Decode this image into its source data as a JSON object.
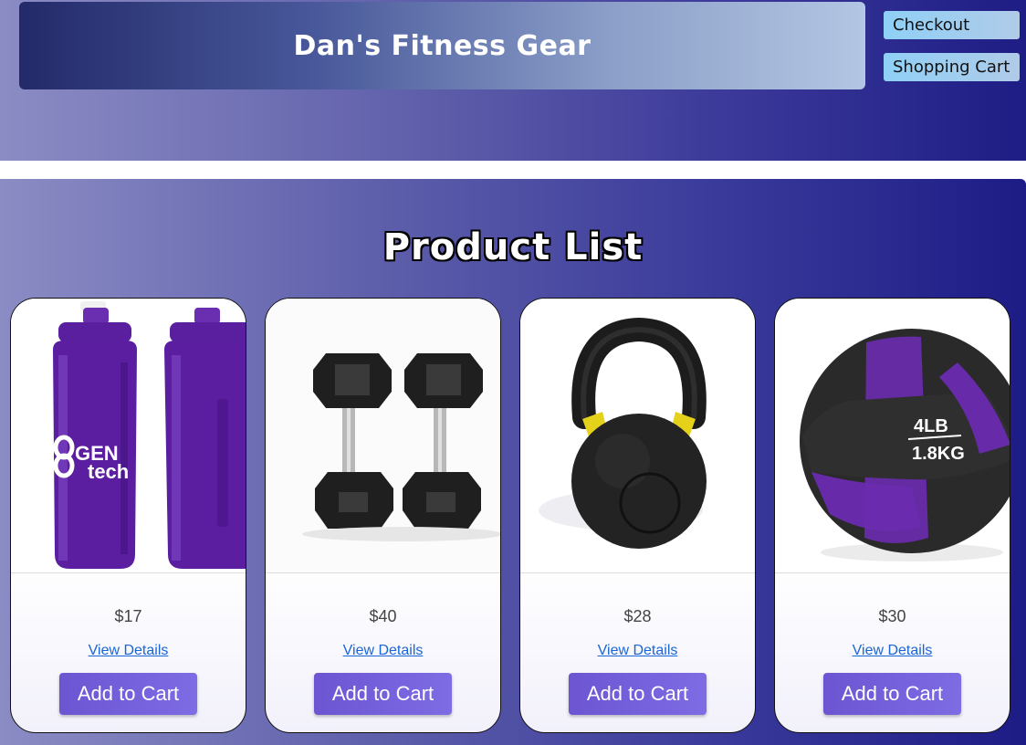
{
  "header": {
    "site_title": "Dan's Fitness Gear",
    "nav": {
      "checkout_label": "Checkout",
      "cart_label": "Shopping Cart"
    }
  },
  "main": {
    "heading": "Product List",
    "products": [
      {
        "image_icon": "water-bottles-icon",
        "image_text": [
          "GEN",
          "tech"
        ],
        "price": "$17",
        "details_label": "View Details",
        "add_label": "Add to Cart"
      },
      {
        "image_icon": "dumbbells-icon",
        "price": "$40",
        "details_label": "View Details",
        "add_label": "Add to Cart"
      },
      {
        "image_icon": "kettlebell-icon",
        "price": "$28",
        "details_label": "View Details",
        "add_label": "Add to Cart"
      },
      {
        "image_icon": "medicine-ball-icon",
        "image_text": [
          "4LB",
          "1.8KG"
        ],
        "price": "$30",
        "details_label": "View Details",
        "add_label": "Add to Cart"
      }
    ]
  },
  "colors": {
    "accent_button": "#6d55d2",
    "link": "#1a66d6",
    "header_gradient_dark": "#1e1d85",
    "bottle_purple": "#5b1ea0",
    "ball_purple": "#6a2bb0"
  }
}
